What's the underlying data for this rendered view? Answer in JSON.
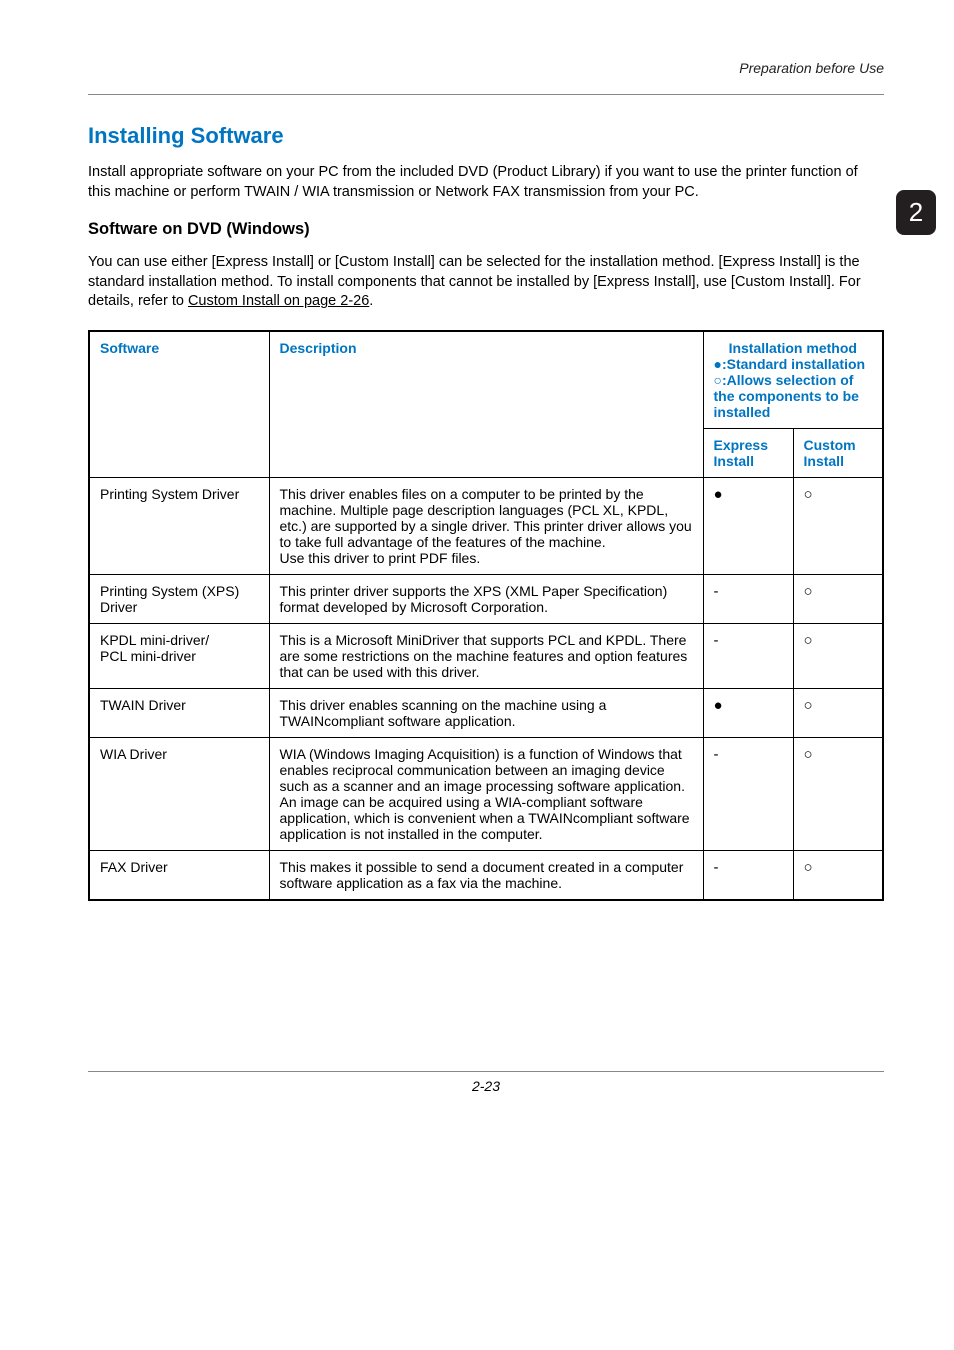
{
  "chapterLabel": "Preparation before Use",
  "sideTab": "2",
  "h1": "Installing Software",
  "intro": "Install appropriate software on your PC from the included DVD (Product Library) if you want to use the printer function of this machine or perform TWAIN / WIA transmission or Network FAX transmission from your PC.",
  "h2": "Software on DVD (Windows)",
  "para2_a": "You can use either [Express Install] or [Custom Install] can be selected for the installation method. [Express Install] is the standard installation method. To install components that cannot be installed by [Express Install], use [Custom Install]. For details, refer to ",
  "para2_link": "Custom Install on page 2-26",
  "para2_b": ".",
  "table": {
    "headers": {
      "software": "Software",
      "description": "Description",
      "installMethod": "Installation method",
      "bullet1": "●:Standard installation",
      "bullet2": "○:Allows selection of the components to be installed",
      "express": "Express Install",
      "custom": "Custom Install"
    },
    "rows": [
      {
        "software": "Printing System Driver",
        "description": "This driver enables files on a computer to be printed by the machine. Multiple page description languages (PCL XL, KPDL, etc.) are supported by a single driver. This printer driver allows you to take full advantage of the features of the machine.\nUse this driver to print PDF files.",
        "express": "●",
        "custom": "○"
      },
      {
        "software": "Printing System (XPS) Driver",
        "description": "This printer driver supports the XPS (XML Paper Specification) format developed by Microsoft Corporation.",
        "express": "-",
        "custom": "○"
      },
      {
        "software": "KPDL mini-driver/\nPCL mini-driver",
        "description": "This is a Microsoft MiniDriver that supports PCL and KPDL. There are some restrictions on the machine features and option features that can be used with this driver.",
        "express": "-",
        "custom": "○"
      },
      {
        "software": "TWAIN Driver",
        "description": "This driver enables scanning on the machine using a TWAINcompliant software application.",
        "express": "●",
        "custom": "○"
      },
      {
        "software": "WIA Driver",
        "description": "WIA (Windows Imaging Acquisition) is a function of Windows that enables reciprocal communication between an imaging device such as a scanner and an image processing software application. An image can be acquired using a WIA-compliant software application, which is convenient when a TWAINcompliant software application is not installed in the computer.",
        "express": "-",
        "custom": "○"
      },
      {
        "software": "FAX Driver",
        "description": "This makes it possible to send a document created in a computer software application as a fax via the machine.",
        "express": "-",
        "custom": "○"
      }
    ]
  },
  "pageNumber": "2-23"
}
